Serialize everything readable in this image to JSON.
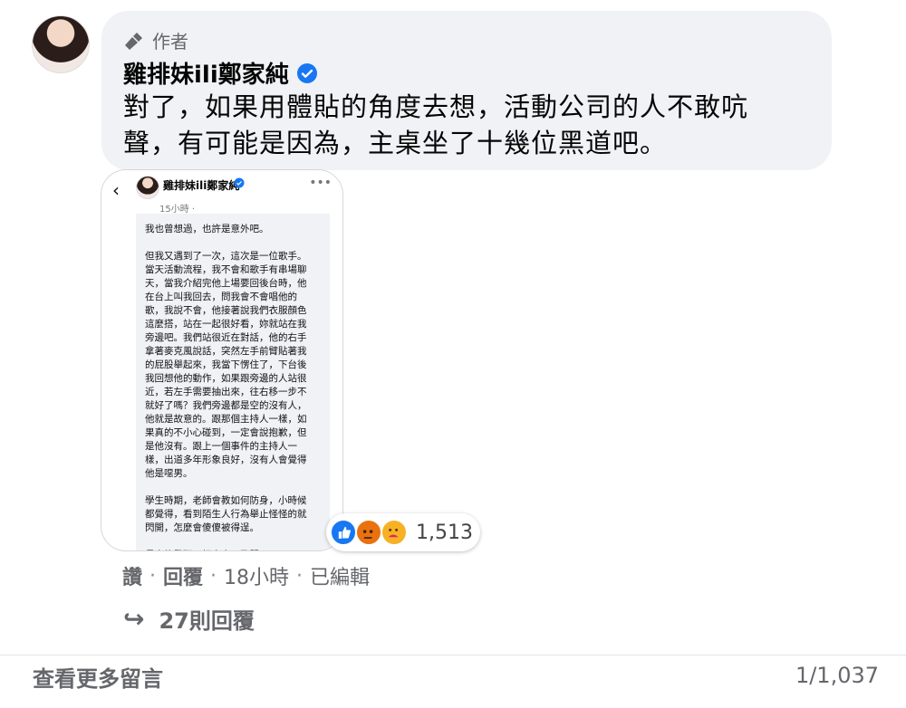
{
  "comment": {
    "badge_label": "作者",
    "author_name": "雞排妹ili鄭家純",
    "text": "對了，如果用體貼的角度去想，活動公司的人不敢吭聲，有可能是因為，主桌坐了十幾位黑道吧。",
    "colors": {
      "bubble": "#f0f2f5",
      "meta": "#65676b",
      "verified": "#1877f2"
    }
  },
  "screenshot": {
    "name": "雞排妹ili鄭家純",
    "time": "15小時 · ",
    "text": "我也曾想過，也許是意外吧。\n\n但我又遇到了一次，這次是一位歌手。\n當天活動流程，我不會和歌手有串場聊\n天，當我介紹完他上場要回後台時，他\n在台上叫我回去，問我會不會唱他的\n歌，我說不會，他接著說我們衣服顏色\n這麼搭，站在一起很好看，妳就站在我\n旁邊吧。我們站很近在對話，他的右手\n拿著麥克風說話，突然左手前臂貼著我\n的屁股舉起來，我當下愣住了，下台後\n我回想他的動作，如果跟旁邊的人站很\n近，若左手需要抽出來，往右移一步不\n就好了嗎？我們旁邊都是空的沒有人，\n他就是故意的。跟那個主持人一樣，如\n果真的不小心碰到，一定會說抱歉，但\n是他沒有。跟上一個事件的主持人一\n樣，出道多年形象良好，沒有人會覺得\n他是噁男。\n\n學生時期，老師會教如何防身，小時候\n都覺得，看到陌生人行為舉止怪怪的就\n閃開，怎麼會傻傻被得逞。\n\n長大後發現，根本來不及閃。"
  },
  "reactions": {
    "count": "1,513"
  },
  "actions": {
    "like": "讚",
    "reply": "回覆",
    "time": "18小時",
    "edited": "已編輯",
    "replies": "27則回覆"
  },
  "footer": {
    "more_comments": "查看更多留言",
    "counter": "1/1,037"
  }
}
